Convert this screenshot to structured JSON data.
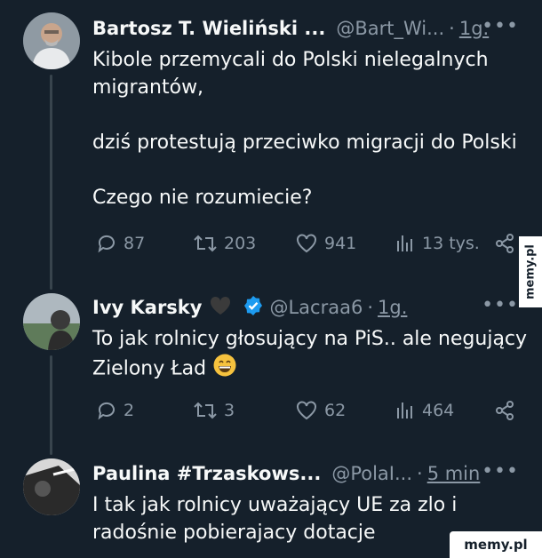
{
  "tweets": [
    {
      "name": "Bartosz T. Wieliński ...",
      "handle": "@Bart_Wi...",
      "time": "1g.",
      "lines": [
        "Kibole przemycali do Polski nielegalnych",
        "migrantów,",
        "",
        "dziś protestują przeciwko migracji do Polski",
        "",
        "Czego nie rozumiecie?"
      ],
      "replies": "87",
      "reposts": "203",
      "likes": "941",
      "views": "13 tys."
    },
    {
      "name": "Ivy Karsky",
      "handle": "@Lacraa6",
      "time": "1g.",
      "lines": [
        "To jak rolnicy głosujący na PiS.. ale negujący",
        "Zielony Ład"
      ],
      "replies": "2",
      "reposts": "3",
      "likes": "62",
      "views": "464"
    },
    {
      "name": "Paulina #Trzaskows...",
      "handle": "@PolaI...",
      "time": "5 min",
      "lines": [
        "I tak jak rolnicy uważający UE za zlo i",
        "radośnie pobierajacy dotacje"
      ]
    }
  ],
  "more_icon": "more-horizontal-icon",
  "watermark": "memy.pl",
  "colors": {
    "background": "#15202b",
    "text": "#f7f9f9",
    "muted": "#8b98a5",
    "verified": "#1d9bf0"
  }
}
